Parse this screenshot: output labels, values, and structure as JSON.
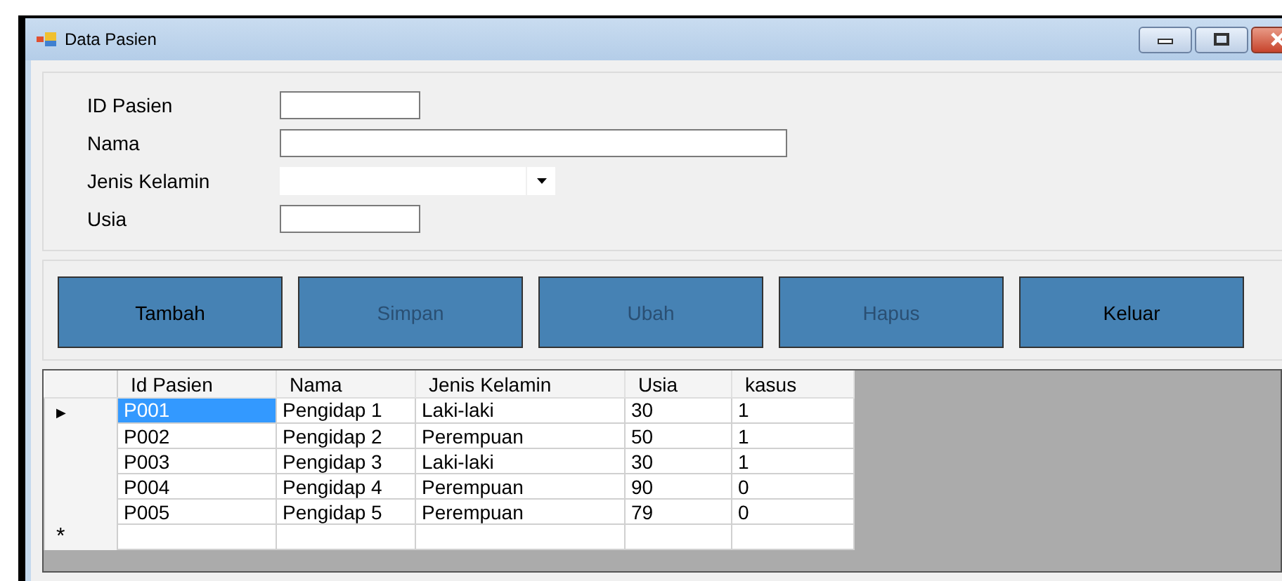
{
  "window": {
    "title": "Data Pasien"
  },
  "form": [
    {
      "label": "ID Pasien",
      "kind": "text"
    },
    {
      "label": "Nama",
      "kind": "text"
    },
    {
      "label": "Jenis Kelamin",
      "kind": "combo"
    },
    {
      "label": "Usia",
      "kind": "text"
    }
  ],
  "buttons": [
    {
      "label": "Tambah",
      "disabled": false
    },
    {
      "label": "Simpan",
      "disabled": true
    },
    {
      "label": "Ubah",
      "disabled": true
    },
    {
      "label": "Hapus",
      "disabled": true
    },
    {
      "label": "Keluar",
      "disabled": false
    }
  ],
  "table": {
    "columns": [
      "Id Pasien",
      "Nama",
      "Jenis Kelamin",
      "Usia",
      "kasus"
    ],
    "rows": [
      {
        "marker": "▶",
        "cells": [
          "P001",
          "Pengidap 1",
          "Laki-laki",
          "30",
          "1"
        ],
        "selected": true
      },
      {
        "cells": [
          "P002",
          "Pengidap 2",
          "Perempuan",
          "50",
          "1"
        ],
        "selected": false
      },
      {
        "cells": [
          "P003",
          "Pengidap 3",
          "Laki-laki",
          "30",
          "1"
        ],
        "selected": false
      },
      {
        "cells": [
          "P004",
          "Pengidap 4",
          "Perempuan",
          "90",
          "0"
        ],
        "selected": false
      },
      {
        "cells": [
          "P005",
          "Pengidap 5",
          "Perempuan",
          "79",
          "0"
        ],
        "selected": false
      }
    ],
    "new_row_marker": "*"
  }
}
